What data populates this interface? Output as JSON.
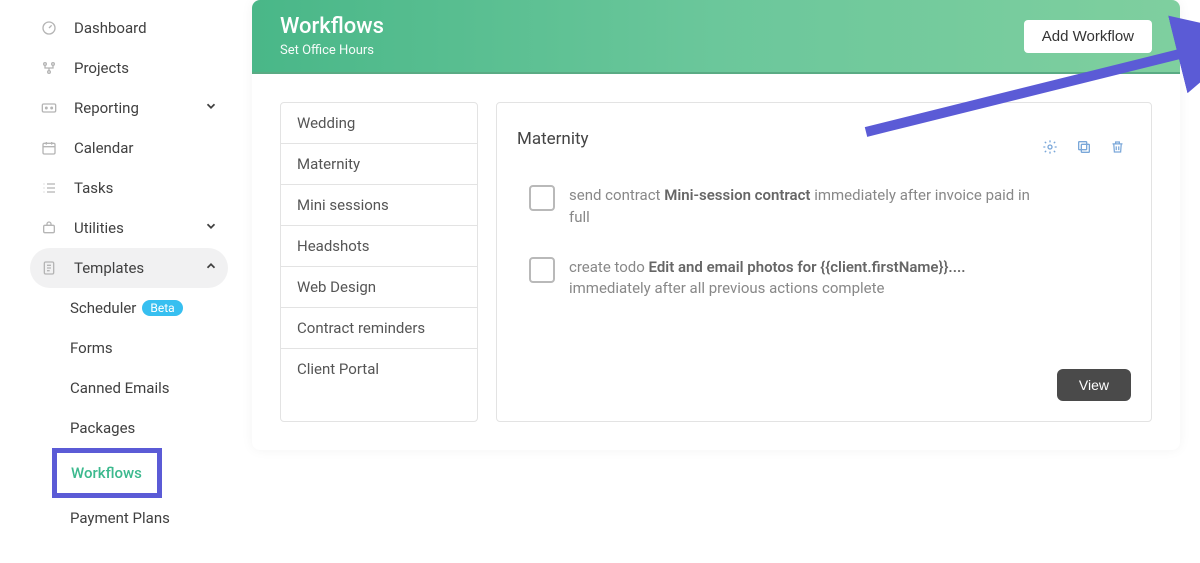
{
  "sidebar": {
    "items": [
      {
        "label": "Dashboard",
        "icon": "dashboard-icon"
      },
      {
        "label": "Projects",
        "icon": "projects-icon"
      },
      {
        "label": "Reporting",
        "icon": "reporting-icon",
        "expandable": true
      },
      {
        "label": "Calendar",
        "icon": "calendar-icon"
      },
      {
        "label": "Tasks",
        "icon": "tasks-icon"
      },
      {
        "label": "Utilities",
        "icon": "utilities-icon",
        "expandable": true
      },
      {
        "label": "Templates",
        "icon": "templates-icon",
        "expandable": true,
        "expanded": true
      }
    ],
    "templates_sub": [
      {
        "label": "Scheduler",
        "badge": "Beta"
      },
      {
        "label": "Forms"
      },
      {
        "label": "Canned Emails"
      },
      {
        "label": "Packages"
      },
      {
        "label": "Workflows",
        "highlighted": true
      },
      {
        "label": "Payment Plans"
      }
    ]
  },
  "header": {
    "title": "Workflows",
    "subtitle": "Set Office Hours",
    "add_button": "Add Workflow"
  },
  "workflow_list": [
    "Wedding",
    "Maternity",
    "Mini sessions",
    "Headshots",
    "Web Design",
    "Contract reminders",
    "Client Portal"
  ],
  "detail": {
    "title": "Maternity",
    "actions": [
      {
        "prefix": "send contract ",
        "bold": "Mini-session contract",
        "suffix": " immediately after invoice paid in full"
      },
      {
        "prefix": "create todo ",
        "bold": "Edit and email photos for {{client.firstName}}....",
        "suffix": " immediately after all previous actions complete"
      }
    ],
    "view_button": "View"
  },
  "colors": {
    "accent_green": "#49b788",
    "highlight_purple": "#5b5bd6",
    "beta_blue": "#37bff0",
    "icon_action_blue": "#7aa7d9"
  }
}
